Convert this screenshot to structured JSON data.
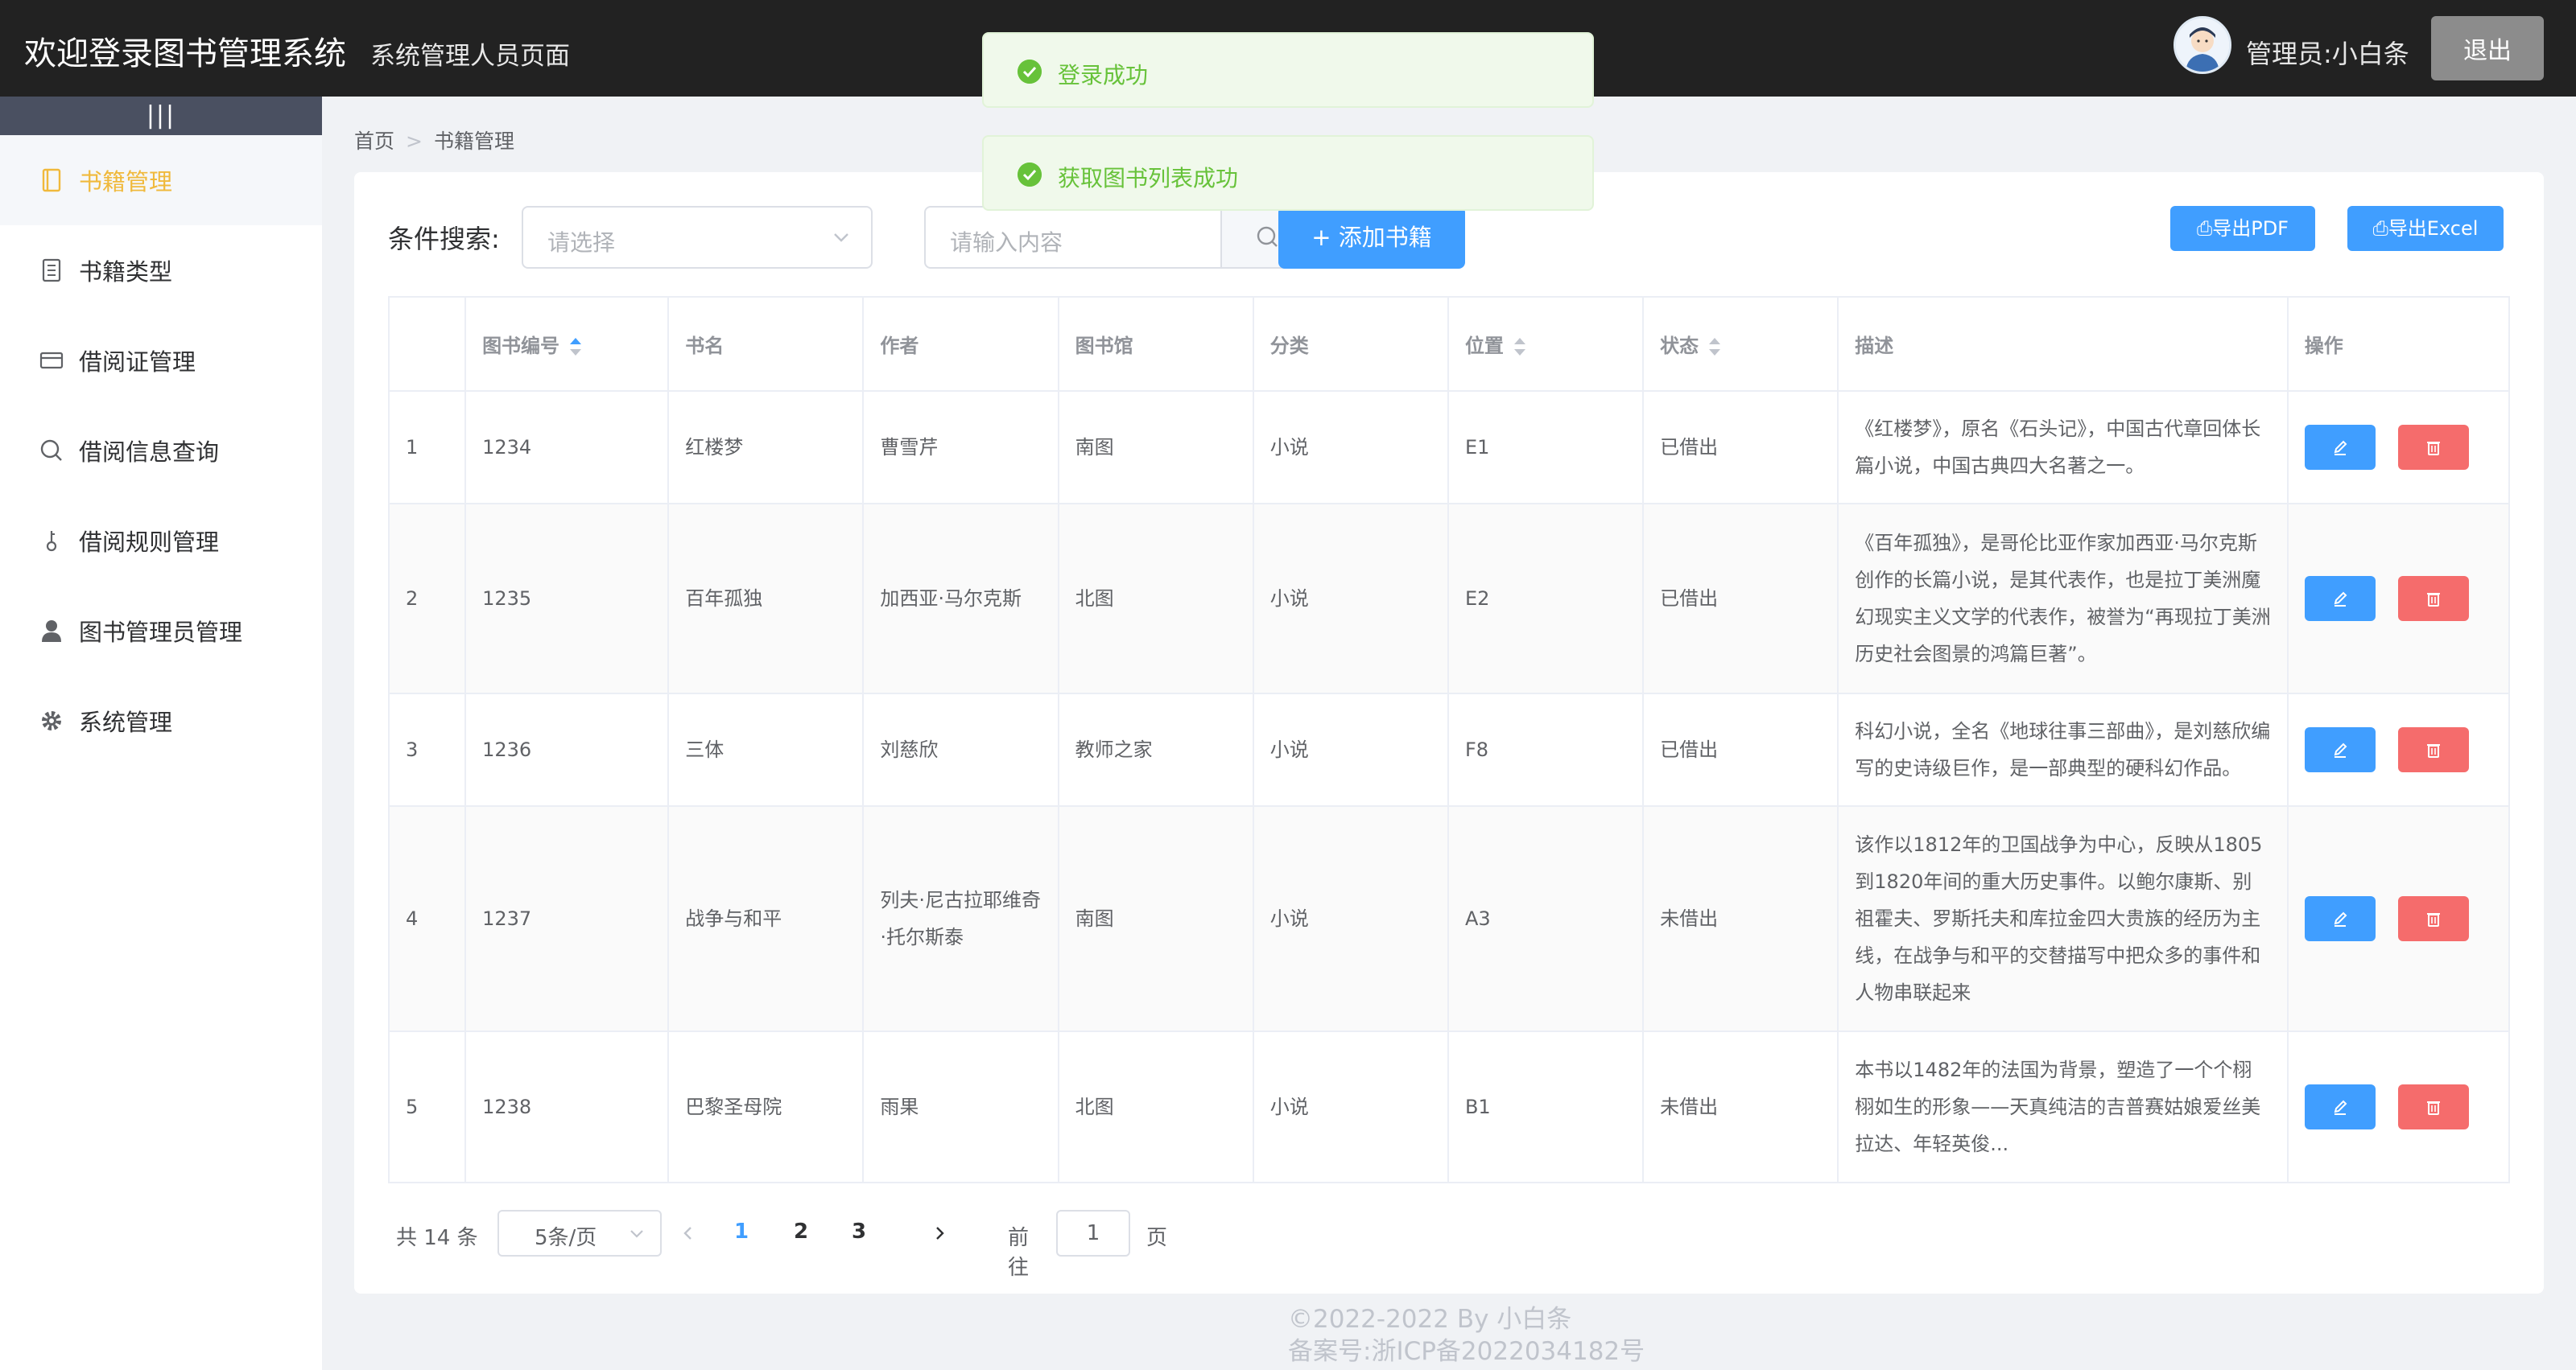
{
  "header": {
    "title": "欢迎登录图书管理系统",
    "subtitle": "系统管理人员页面",
    "admin_label": "管理员:小白条",
    "logout_label": "退出"
  },
  "sidebar": {
    "toggle_glyph": "|||",
    "items": [
      {
        "label": "书籍管理",
        "icon": "book-icon"
      },
      {
        "label": "书籍类型",
        "icon": "document-icon"
      },
      {
        "label": "借阅证管理",
        "icon": "card-icon"
      },
      {
        "label": "借阅信息查询",
        "icon": "search-icon"
      },
      {
        "label": "借阅规则管理",
        "icon": "key-icon"
      },
      {
        "label": "图书管理员管理",
        "icon": "user-icon"
      },
      {
        "label": "系统管理",
        "icon": "gear-icon"
      }
    ],
    "active_index": 0
  },
  "breadcrumb": {
    "home": "首页",
    "current": "书籍管理"
  },
  "toolbar": {
    "search_label": "条件搜索:",
    "select_placeholder": "请选择",
    "input_placeholder": "请输入内容",
    "add_label": "添加书籍",
    "export_pdf_label": "导出PDF",
    "export_excel_label": "导出Excel"
  },
  "table": {
    "columns": [
      "",
      "图书编号",
      "书名",
      "作者",
      "图书馆",
      "分类",
      "位置",
      "状态",
      "描述",
      "操作"
    ],
    "rows": [
      {
        "index": "1",
        "id": "1234",
        "name": "红楼梦",
        "author": "曹雪芹",
        "library": "南图",
        "category": "小说",
        "location": "E1",
        "status": "已借出",
        "desc": "《红楼梦》，原名《石头记》，中国古代章回体长篇小说，中国古典四大名著之一。"
      },
      {
        "index": "2",
        "id": "1235",
        "name": "百年孤独",
        "author": "加西亚·马尔克斯",
        "library": "北图",
        "category": "小说",
        "location": "E2",
        "status": "已借出",
        "desc": "《百年孤独》，是哥伦比亚作家加西亚·马尔克斯创作的长篇小说，是其代表作，也是拉丁美洲魔幻现实主义文学的代表作，被誉为“再现拉丁美洲历史社会图景的鸿篇巨著”。"
      },
      {
        "index": "3",
        "id": "1236",
        "name": "三体",
        "author": "刘慈欣",
        "library": "教师之家",
        "category": "小说",
        "location": "F8",
        "status": "已借出",
        "desc": "科幻小说，全名《地球往事三部曲》，是刘慈欣编写的史诗级巨作，是一部典型的硬科幻作品。"
      },
      {
        "index": "4",
        "id": "1237",
        "name": "战争与和平",
        "author": "列夫·尼古拉耶维奇·托尔斯泰",
        "library": "南图",
        "category": "小说",
        "location": "A3",
        "status": "未借出",
        "desc": "该作以1812年的卫国战争为中心，反映从1805到1820年间的重大历史事件。以鲍尔康斯、别祖霍夫、罗斯托夫和库拉金四大贵族的经历为主线，在战争与和平的交替描写中把众多的事件和人物串联起来"
      },
      {
        "index": "5",
        "id": "1238",
        "name": "巴黎圣母院",
        "author": "雨果",
        "library": "北图",
        "category": "小说",
        "location": "B1",
        "status": "未借出",
        "desc": "本书以1482年的法国为背景，塑造了一个个栩栩如生的形象——天真纯洁的吉普赛姑娘爱丝美拉达、年轻英俊..."
      }
    ]
  },
  "pagination": {
    "total": "共 14 条",
    "page_size": "5条/页",
    "pages": [
      "1",
      "2",
      "3"
    ],
    "current_page": "1",
    "goto_label": "前往",
    "goto_value": "1",
    "goto_suffix": "页"
  },
  "footer": {
    "copyright": "©2022-2022 By 小白条",
    "icp": "备案号:浙ICP备2022034182号"
  },
  "toasts": [
    {
      "message": "登录成功"
    },
    {
      "message": "获取图书列表成功"
    }
  ],
  "colors": {
    "header_bg": "#222222",
    "primary": "#409eff",
    "danger": "#f56c6c",
    "success": "#67c23a",
    "active_menu": "#f0b93c"
  }
}
